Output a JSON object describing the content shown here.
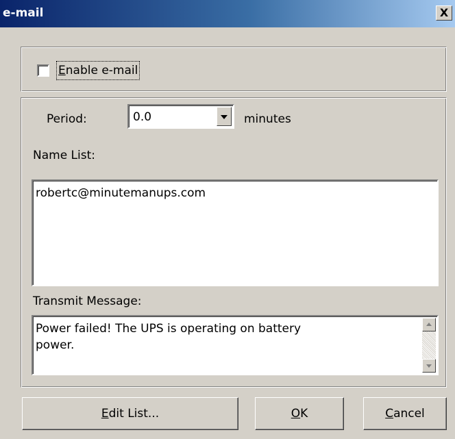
{
  "window": {
    "title": "e-mail",
    "close_glyph": "X"
  },
  "enable": {
    "label_mnemonic": "E",
    "label_rest": "nable e-mail",
    "checked": false
  },
  "period": {
    "label": "Period:",
    "value": "0.0",
    "unit": "minutes"
  },
  "name_list": {
    "label": "Name List:",
    "entries": [
      "robertc@minutemanups.com"
    ]
  },
  "transmit": {
    "label": "Transmit Message:",
    "line1": "Power failed! The UPS is operating on battery",
    "line2": "power."
  },
  "buttons": {
    "edit_mnemonic": "E",
    "edit_rest": "dit List...",
    "ok_mnemonic": "O",
    "ok_rest": "K",
    "cancel_mnemonic": "C",
    "cancel_rest": "ancel"
  },
  "colors": {
    "dialog_bg": "#d4d0c8",
    "title_start": "#0a246a",
    "title_end": "#a6caf0"
  }
}
